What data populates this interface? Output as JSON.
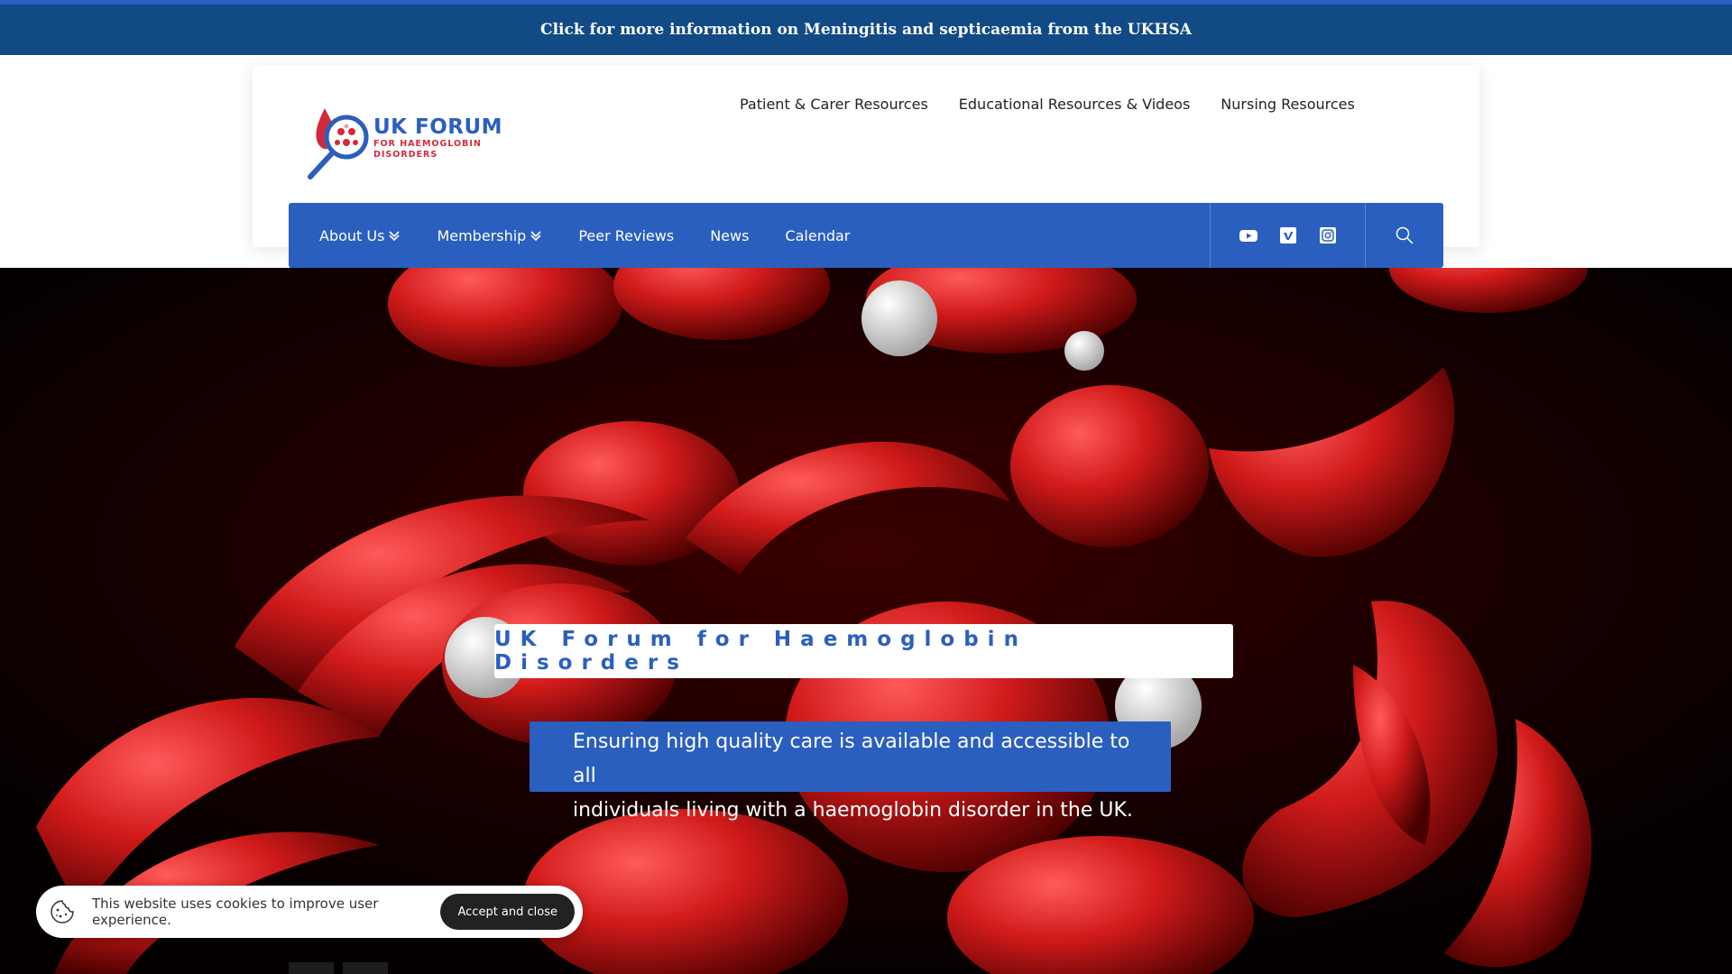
{
  "announcement": {
    "text": "Click for more information on Meningitis and septicaemia from the UKHSA"
  },
  "logo": {
    "title": "UK FORUM",
    "sub1": "FOR HAEMOGLOBIN",
    "sub2": "DISORDERS"
  },
  "top_links": [
    {
      "label": "Patient & Carer Resources"
    },
    {
      "label": "Educational Resources & Videos"
    },
    {
      "label": "Nursing Resources"
    }
  ],
  "nav": {
    "items": [
      {
        "label": "About Us",
        "dropdown": true
      },
      {
        "label": "Membership",
        "dropdown": true
      },
      {
        "label": "Peer Reviews",
        "dropdown": false
      },
      {
        "label": "News",
        "dropdown": false
      },
      {
        "label": "Calendar",
        "dropdown": false
      }
    ],
    "social": [
      "youtube-icon",
      "vimeo-icon",
      "instagram-icon"
    ],
    "search_icon": "search-icon"
  },
  "hero": {
    "title": "UK Forum for Haemoglobin Disorders",
    "subtitle_line1": "Ensuring high quality care is available and accessible to all",
    "subtitle_line2": "individuals living with a haemoglobin disorder in the UK."
  },
  "cookie": {
    "text": "This website uses cookies to improve user experience.",
    "button": "Accept and close"
  },
  "colors": {
    "brand_blue": "#2b5fbf",
    "announce_bg": "#124a86",
    "brand_red": "#d22a3a",
    "hero_bg": "#050000"
  }
}
